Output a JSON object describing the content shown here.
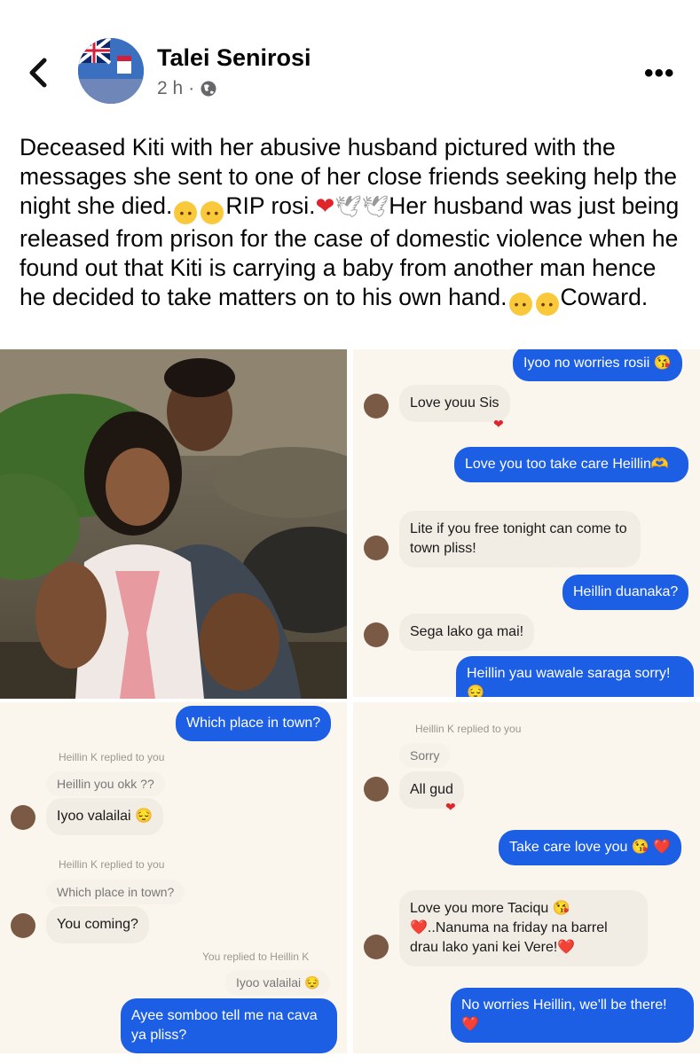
{
  "header": {
    "back_icon": "chevron-left-icon",
    "author": "Talei Senirosi",
    "time": "2 h",
    "dot": "·",
    "privacy_icon": "globe-icon",
    "more_icon": "more-icon",
    "more_glyph": "•••"
  },
  "post": {
    "caption_parts": {
      "a": "Deceased Kiti with her abusive husband pictured with the messages she sent to one of her close friends seeking help the night she died.",
      "b": "RIP rosi.",
      "c": "Her husband was  just being released from prison for the case of domestic violence when he found out that Kiti is carrying a baby from another man hence he decided to take matters on to his own hand.",
      "d": "Coward."
    }
  },
  "chat1": {
    "out1": "Iyoo no worries rosii 😘",
    "in1": "Love youu Sis",
    "out2": "Love you too take care Heillin🫶",
    "in2": "Lite if you free tonight can come to town pliss!",
    "out3": "Heillin duanaka?",
    "in3": "Sega lako ga mai!",
    "out4": "Heillin yau wawale saraga sorry! 😔"
  },
  "chat2": {
    "out1": "Which place in town?",
    "reply1": "Heillin K replied to you",
    "quote1": "Heillin you okk ??",
    "in1": "Iyoo valailai 😔",
    "reply2": "Heillin K replied to you",
    "quote2": "Which place in town?",
    "in2": "You coming?",
    "reply3": "You replied to Heillin K",
    "quote3": "Iyoo valailai 😔",
    "out2": "Ayee somboo tell me na cava ya pliss?"
  },
  "chat3": {
    "reply1": "Heillin K replied to you",
    "quote1": "Sorry",
    "in1": "All gud",
    "out1": "Take care love you 😘 ❤️",
    "in2": "Love you more Taciqu 😘 ❤️..Nanuma na friday na barrel drau lako yani kei Vere!❤️",
    "out2": "No worries Heillin, we'll be there! ❤️"
  }
}
